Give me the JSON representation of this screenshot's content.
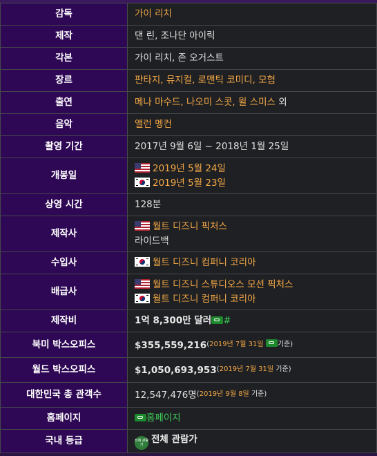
{
  "rows": {
    "director": {
      "label": "감독",
      "value": "가이 리치"
    },
    "production": {
      "label": "제작",
      "value": "댄 린, 조나단 아이릭"
    },
    "screenplay": {
      "label": "각본",
      "value": "가이 리치, 존 오거스트"
    },
    "genre": {
      "label": "장르",
      "value": "판타지, 뮤지컬, 로맨틱 코미디, 모험"
    },
    "cast": {
      "label": "출연",
      "value": "메나 마수드, 나오미 스콧, 윌 스미스",
      "suffix": " 외"
    },
    "music": {
      "label": "음악",
      "value": "앨런 멩컨"
    },
    "filming": {
      "label": "촬영 기간",
      "value": "2017년 9월 6일 ~ 2018년 1월 25일"
    },
    "release": {
      "label": "개봉일",
      "us": "2019년 5월 24일",
      "kr": "2019년 5월 23일"
    },
    "runtime": {
      "label": "상영 시간",
      "value": "128분"
    },
    "studio": {
      "label": "제작사",
      "us": "월트 디즈니 픽처스",
      "other": "라이드백"
    },
    "importer": {
      "label": "수입사",
      "kr": "월트 디즈니 컴퍼니 코리아"
    },
    "distributor": {
      "label": "배급사",
      "us": "월트 디즈니 스튜디오스 모션 픽처스",
      "kr": "월트 디즈니 컴퍼니 코리아"
    },
    "budget": {
      "label": "제작비",
      "value": "1억 8,300만 달러",
      "hash": "#"
    },
    "na_box": {
      "label": "북미 박스오피스",
      "value": "$355,559,216",
      "note_open": "(",
      "note_date": "2019년 7월 31일",
      "note_close": "기준)"
    },
    "world_box": {
      "label": "월드 박스오피스",
      "value": "$1,050,693,953",
      "note_open": "(",
      "note_date": "2019년 7월 31일",
      "note_close": " 기준)"
    },
    "kr_audience": {
      "label": "대한민국 총 관객수",
      "value": "12,547,476명",
      "note_open": "(",
      "note_date": "2019년 9월 8일",
      "note_close": " 기준)"
    },
    "homepage": {
      "label": "홈페이지",
      "value": "홈페이지"
    },
    "rating": {
      "label": "국내 등급",
      "value": "전체 관람가",
      "badge": "전체 관람가"
    }
  },
  "colors": {
    "label_bg": "#2e0854",
    "value_bg": "#1f2023",
    "link": "#f3a847",
    "external_link": "#3ccf57"
  }
}
